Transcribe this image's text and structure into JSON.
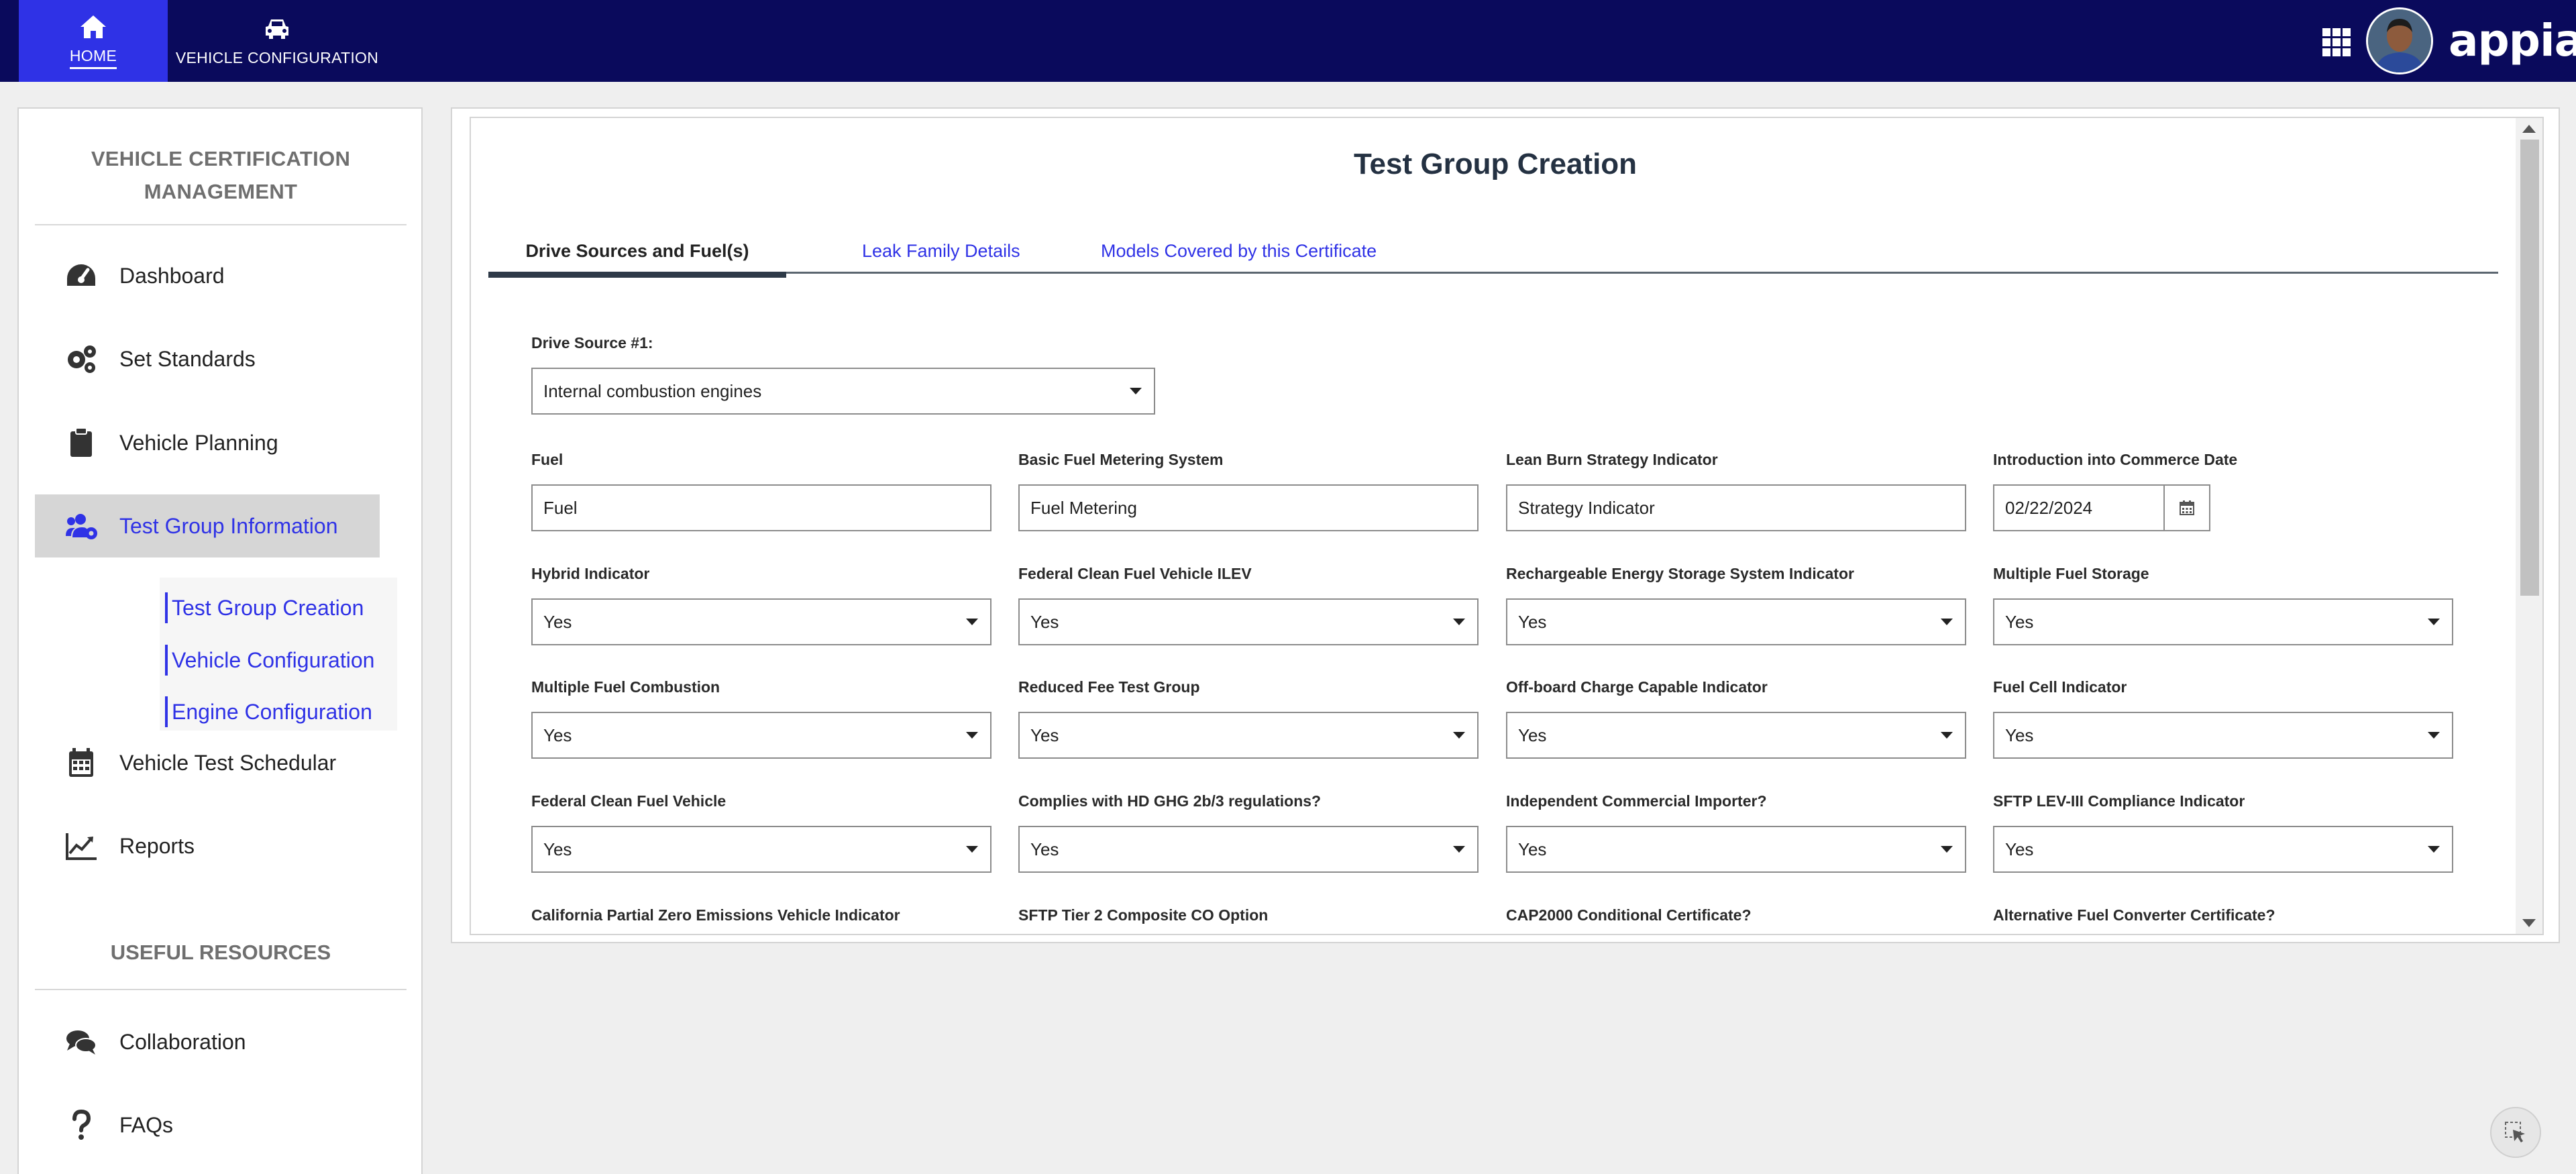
{
  "header": {
    "brand": "appian",
    "nav": [
      {
        "label": "HOME",
        "icon": "home-icon",
        "active": true
      },
      {
        "label": "VEHICLE CONFIGURATION",
        "icon": "car-icon",
        "active": false
      }
    ],
    "colors": {
      "bar": "#0a0a5c",
      "active_tab": "#2f32e6"
    }
  },
  "sidebar": {
    "title": "VEHICLE CERTIFICATION MANAGEMENT",
    "items": [
      {
        "label": "Dashboard",
        "icon": "speedometer-icon"
      },
      {
        "label": "Set Standards",
        "icon": "gears-icon"
      },
      {
        "label": "Vehicle Planning",
        "icon": "clipboard-icon"
      },
      {
        "label": "Test Group Information",
        "icon": "users-cog-icon",
        "active": true
      },
      {
        "label": "Vehicle Test Schedular",
        "icon": "calendar-icon"
      },
      {
        "label": "Reports",
        "icon": "chart-line-icon"
      }
    ],
    "subitems": [
      "Test Group Creation",
      "Vehicle Configuration",
      "Engine Configuration"
    ],
    "resources_title": "USEFUL RESOURCES",
    "resources": [
      {
        "label": "Collaboration",
        "icon": "comments-icon"
      },
      {
        "label": "FAQs",
        "icon": "question-icon"
      }
    ]
  },
  "main": {
    "title": "Test Group Creation",
    "tabs": [
      {
        "label": "Drive Sources and Fuel(s)",
        "active": true
      },
      {
        "label": "Leak Family Details",
        "active": false
      },
      {
        "label": "Models Covered by this Certificate",
        "active": false
      }
    ],
    "drive_source": {
      "label": "Drive Source #1:",
      "value": "Internal combustion engines"
    },
    "text_fields": [
      {
        "label": "Fuel",
        "value": "Fuel"
      },
      {
        "label": "Basic Fuel Metering System",
        "value": "Fuel Metering"
      },
      {
        "label": "Lean Burn Strategy Indicator",
        "value": "Strategy Indicator"
      }
    ],
    "date_field": {
      "label": "Introduction into Commerce Date",
      "value": "02/22/2024"
    },
    "select_rows": [
      [
        {
          "label": "Hybrid Indicator",
          "value": "Yes"
        },
        {
          "label": "Federal Clean Fuel Vehicle ILEV",
          "value": "Yes"
        },
        {
          "label": "Rechargeable Energy Storage System Indicator",
          "value": "Yes"
        },
        {
          "label": "Multiple Fuel Storage",
          "value": "Yes"
        }
      ],
      [
        {
          "label": "Multiple Fuel Combustion",
          "value": "Yes"
        },
        {
          "label": "Reduced Fee Test Group",
          "value": "Yes"
        },
        {
          "label": "Off-board Charge Capable Indicator",
          "value": "Yes"
        },
        {
          "label": "Fuel Cell Indicator",
          "value": "Yes"
        }
      ],
      [
        {
          "label": "Federal Clean Fuel Vehicle",
          "value": "Yes"
        },
        {
          "label": "Complies with HD GHG 2b/3 regulations?",
          "value": "Yes"
        },
        {
          "label": "Independent Commercial Importer?",
          "value": "Yes"
        },
        {
          "label": "SFTP LEV-III Compliance Indicator",
          "value": "Yes"
        }
      ]
    ],
    "bottom_labels": [
      "California Partial Zero Emissions Vehicle Indicator",
      "SFTP Tier 2 Composite CO Option",
      "CAP2000 Conditional Certificate?",
      "Alternative Fuel Converter Certificate?"
    ]
  }
}
